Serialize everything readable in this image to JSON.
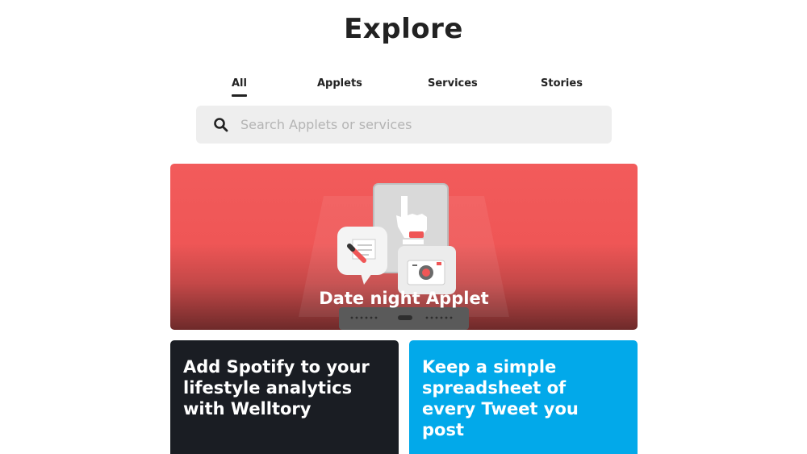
{
  "page": {
    "title": "Explore"
  },
  "tabs": [
    {
      "label": "All",
      "active": true
    },
    {
      "label": "Applets",
      "active": false
    },
    {
      "label": "Services",
      "active": false
    },
    {
      "label": "Stories",
      "active": false
    }
  ],
  "search": {
    "placeholder": "Search Applets or services",
    "value": "",
    "icon": "search-icon"
  },
  "featured": {
    "title": "Date night Applet",
    "background_color": "#f25b5b",
    "icons": [
      "pointing-hand-icon",
      "note-pencil-icon",
      "camera-icon",
      "phone-icon"
    ]
  },
  "cards": [
    {
      "title": "Add Spotify to your lifestyle analytics with Welltory",
      "background_color": "#1a1d23"
    },
    {
      "title": "Keep a simple spreadsheet of every Tweet you post",
      "background_color": "#02a9ea"
    }
  ]
}
